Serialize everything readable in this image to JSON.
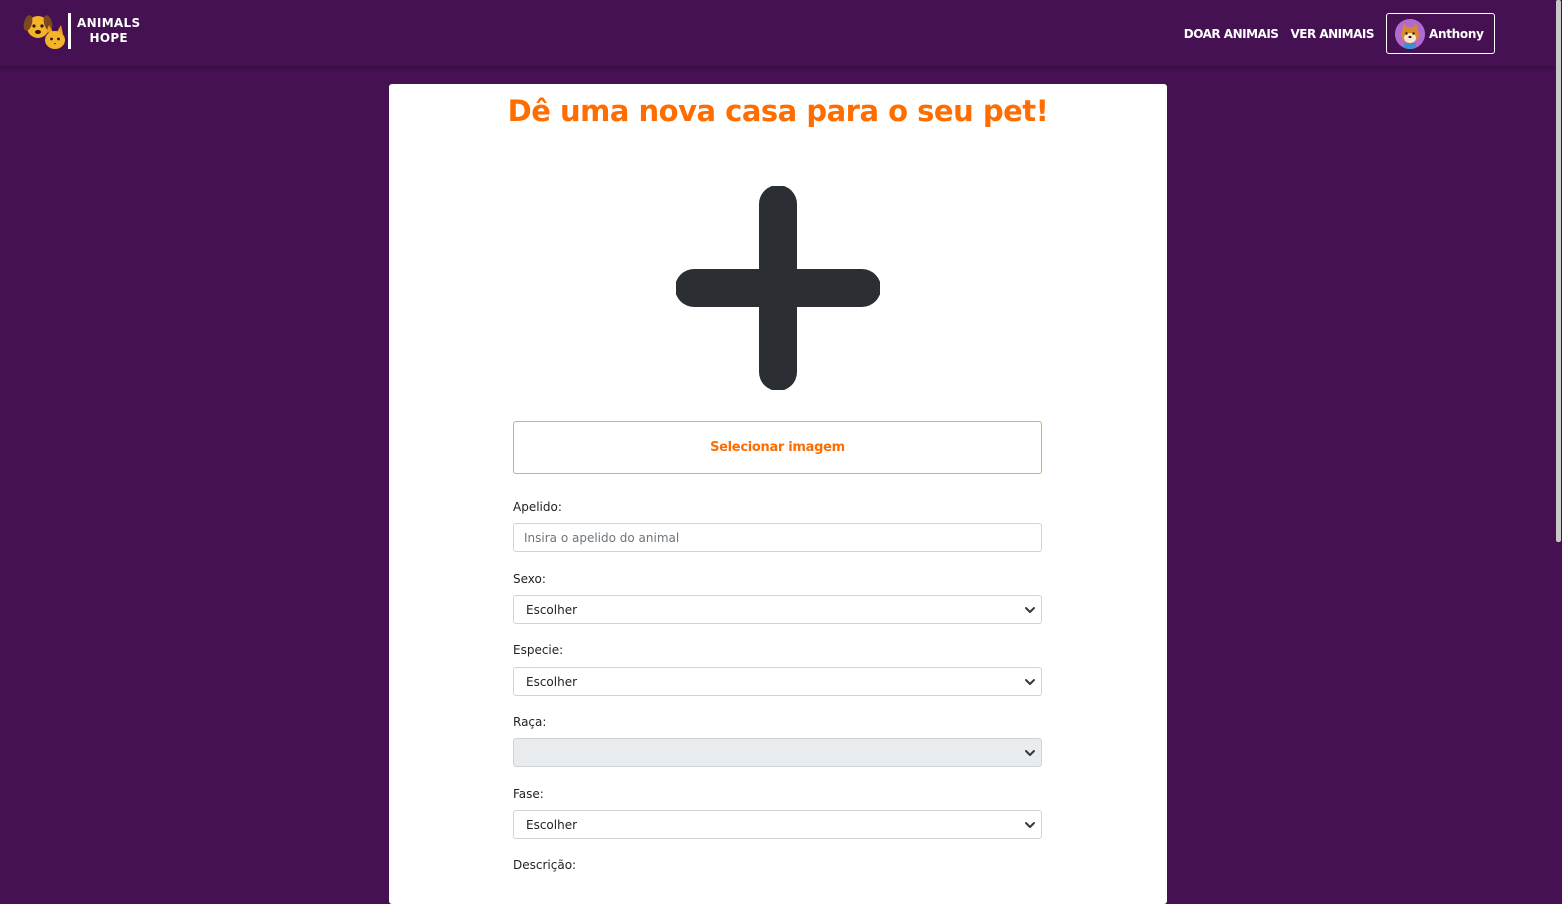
{
  "brand": {
    "line1": "ANIMALS",
    "line2": "HOPE",
    "logo_icon": "dog-and-cat-logo-icon"
  },
  "nav": {
    "donate_label": "DOAR ANIMAIS",
    "view_label": "VER ANIMAIS",
    "user_name": "Anthony",
    "avatar_icon": "shiba-avatar-icon"
  },
  "form": {
    "title": "Dê uma nova casa para o seu pet!",
    "add_image_icon": "plus-icon",
    "select_image_label": "Selecionar imagem",
    "nickname": {
      "label": "Apelido:",
      "placeholder": "Insira o apelido do animal",
      "value": ""
    },
    "sex": {
      "label": "Sexo:",
      "selected": "Escolher"
    },
    "species": {
      "label": "Especie:",
      "selected": "Escolher"
    },
    "breed": {
      "label": "Raça:",
      "selected": "",
      "disabled": true
    },
    "stage": {
      "label": "Fase:",
      "selected": "Escolher"
    },
    "description": {
      "label": "Descrição:"
    }
  },
  "colors": {
    "background": "#461152",
    "accent": "#ff6d00",
    "button_border": "#f7a44c",
    "icon_dark": "#2b2f33"
  }
}
